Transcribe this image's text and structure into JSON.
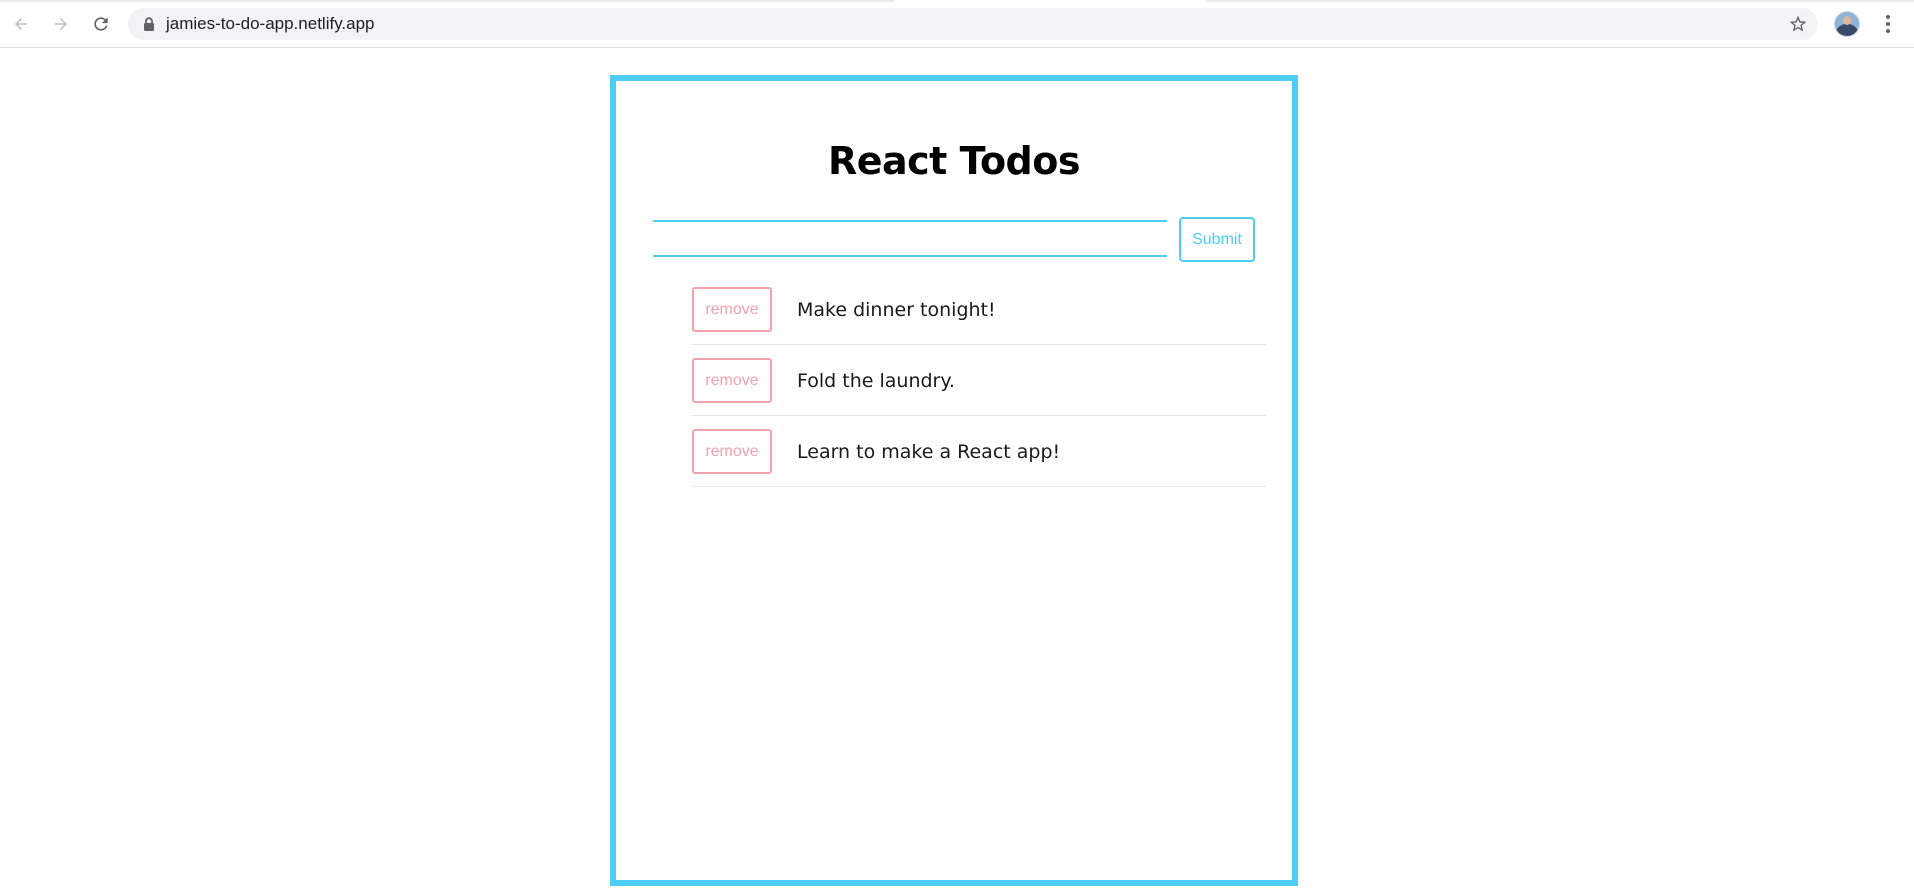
{
  "browser": {
    "url": "jamies-to-do-app.netlify.app",
    "icons": {
      "back": "arrow-left-icon",
      "forward": "arrow-right-icon",
      "reload": "reload-icon",
      "lock": "lock-icon",
      "bookmark": "star-icon",
      "menu": "kebab-menu-icon"
    }
  },
  "app": {
    "title": "React Todos",
    "input": {
      "value": "",
      "placeholder": ""
    },
    "submit_label": "Submit",
    "remove_label": "remove",
    "todos": [
      {
        "text": "Make dinner tonight!"
      },
      {
        "text": "Fold the laundry."
      },
      {
        "text": "Learn to make a React app!"
      }
    ]
  },
  "colors": {
    "accent": "#4ecdf5",
    "remove": "#f3a2ab",
    "divider": "#e6e6e6"
  }
}
